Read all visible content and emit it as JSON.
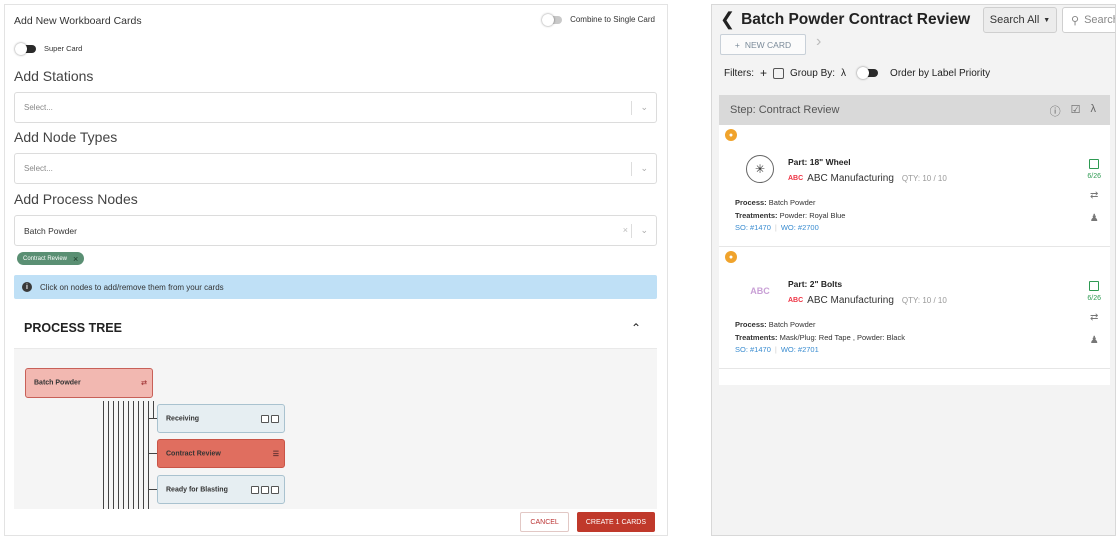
{
  "left": {
    "title": "Add New Workboard Cards",
    "combine_label": "Combine to Single Card",
    "super_card_label": "Super Card",
    "stations": {
      "title": "Add Stations",
      "placeholder": "Select..."
    },
    "node_types": {
      "title": "Add Node Types",
      "placeholder": "Select..."
    },
    "process_nodes": {
      "title": "Add Process Nodes",
      "value": "Batch Powder"
    },
    "chip_label": "Contract Review",
    "info_text": "Click on nodes to add/remove them from your cards",
    "tree_title": "PROCESS TREE",
    "tree": {
      "root": "Batch Powder",
      "nodes": [
        "Receiving",
        "Contract Review",
        "Ready for Blasting"
      ]
    },
    "cancel_label": "CANCEL",
    "create_label": "CREATE 1 CARDS"
  },
  "right": {
    "title": "Batch Powder Contract Review",
    "search_all": "Search All",
    "search_placeholder": "Search",
    "new_card": "NEW CARD",
    "filters_label": "Filters:",
    "group_by_label": "Group By:",
    "order_label": "Order by Label Priority",
    "step_title": "Step: Contract Review",
    "cards": [
      {
        "part": "Part: 18\" Wheel",
        "manufacturer": "ABC Manufacturing",
        "qty": "QTY: 10 / 10",
        "process_label": "Process:",
        "process": "Batch Powder",
        "treatments_label": "Treatments:",
        "treatments": "Powder: Royal Blue",
        "so": "SO: #1470",
        "wo": "WO: #2700",
        "date": "6/26"
      },
      {
        "part": "Part: 2\" Bolts",
        "manufacturer": "ABC Manufacturing",
        "qty": "QTY: 10 / 10",
        "process_label": "Process:",
        "process": "Batch Powder",
        "treatments_label": "Treatments:",
        "treatments": "Mask/Plug: Red Tape , Powder: Black",
        "so": "SO: #1470",
        "wo": "WO: #2701",
        "date": "6/26"
      }
    ]
  },
  "colors": {
    "accent_red": "#c0392b",
    "chip_green": "#5a8f73",
    "info_blue": "#bfe0f6",
    "link_blue": "#3a8cd0",
    "date_green": "#2e9a52",
    "avatar_orange": "#f0a32c"
  }
}
